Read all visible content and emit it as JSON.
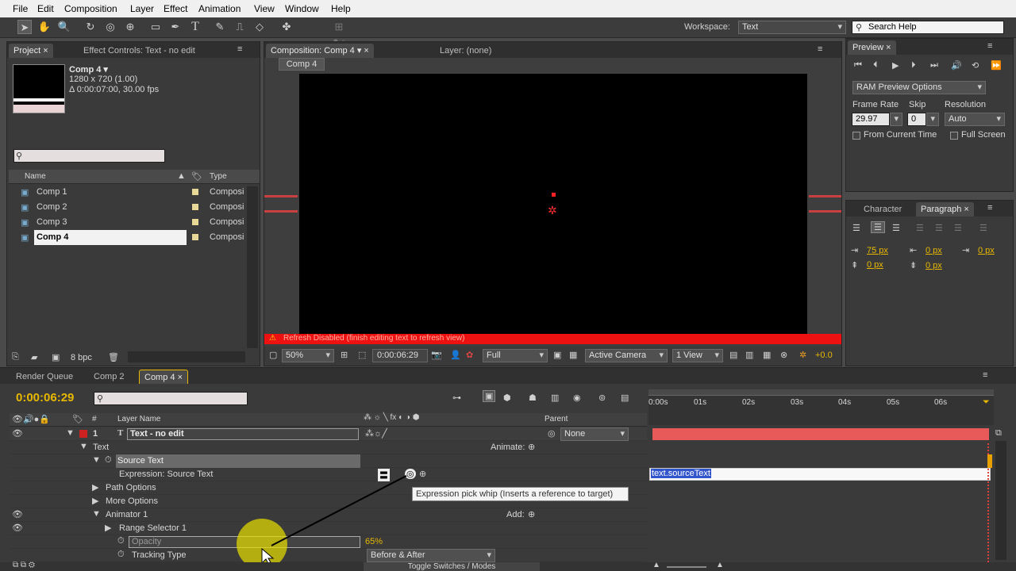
{
  "menu": [
    "File",
    "Edit",
    "Composition",
    "Layer",
    "Effect",
    "Animation",
    "View",
    "Window",
    "Help"
  ],
  "toolbar": {
    "workspace_label": "Workspace:",
    "workspace_value": "Text",
    "search_placeholder": "Search Help"
  },
  "project": {
    "tab_project": "Project",
    "tab_effects": "Effect Controls: Text - no edit",
    "comp_name": "Comp 4 ▾",
    "comp_res": "1280 x 720 (1.00)",
    "comp_dur": "Δ 0:00:07:00, 30.00 fps",
    "col_name": "Name",
    "col_type": "Type",
    "items": [
      {
        "name": "Comp 1",
        "type": "Composi"
      },
      {
        "name": "Comp 2",
        "type": "Composi"
      },
      {
        "name": "Comp 3",
        "type": "Composi"
      },
      {
        "name": "Comp 4",
        "type": "Composi"
      }
    ],
    "bpc": "8 bpc"
  },
  "viewer": {
    "tab_comp": "Composition: Comp 4",
    "tab_layer": "Layer: (none)",
    "subtab": "Comp 4",
    "warning": "Refresh Disabled (finish editing text to refresh view)",
    "zoom": "50%",
    "timecode": "0:00:06:29",
    "resolution": "Full",
    "camera": "Active Camera",
    "views": "1 View",
    "exposure": "+0.0"
  },
  "preview": {
    "title": "Preview",
    "ram": "RAM Preview Options",
    "frame_rate_label": "Frame Rate",
    "skip_label": "Skip",
    "resolution_label": "Resolution",
    "frame_rate": "29.97",
    "skip": "0",
    "resolution": "Auto",
    "from_current": "From Current Time",
    "full_screen": "Full Screen"
  },
  "paragraph": {
    "tab_character": "Character",
    "tab_paragraph": "Paragraph",
    "indent_left": "75 px",
    "indent_first": "0 px",
    "indent_right": "0 px",
    "space_before": "0 px",
    "space_after": "0 px"
  },
  "timeline": {
    "tabs": [
      "Render Queue",
      "Comp 2",
      "Comp 4"
    ],
    "timecode": "0:00:06:29",
    "col_num": "#",
    "col_layer": "Layer Name",
    "col_parent": "Parent",
    "ruler": [
      "0:00s",
      "01s",
      "02s",
      "03s",
      "04s",
      "05s",
      "06s"
    ],
    "layer_num": "1",
    "layer_name": "Text - no edit",
    "parent": "None",
    "text_label": "Text",
    "animate_label": "Animate:",
    "source_text": "Source Text",
    "expression_label": "Expression: Source Text",
    "path_options": "Path Options",
    "more_options": "More Options",
    "animator": "Animator 1",
    "add_label": "Add:",
    "range_selector": "Range Selector 1",
    "opacity": "Opacity",
    "opacity_value": "65%",
    "tracking_type": "Tracking Type",
    "tracking_value": "Before & After",
    "expression_code": "text.sourceText",
    "tooltip": "Expression pick whip (Inserts a reference to target)",
    "toggle": "Toggle Switches / Modes"
  },
  "colors": {
    "label_red": "#cc2222",
    "layer_bar": "#e85a5a",
    "cursor_highlight": "#e8e000",
    "timecode": "#e8b800"
  }
}
